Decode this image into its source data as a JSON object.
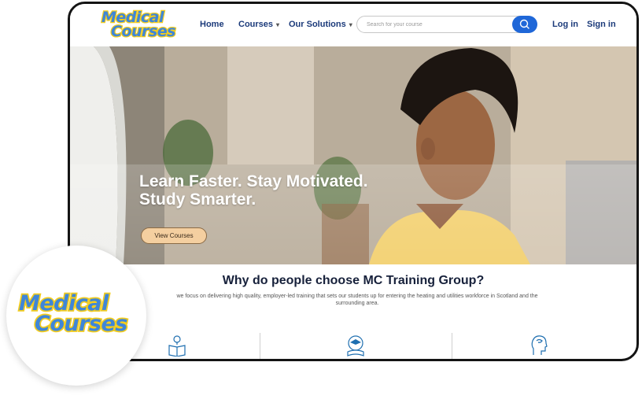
{
  "brand": {
    "logo_line1": "Medical",
    "logo_line2": "Courses"
  },
  "nav": {
    "home": "Home",
    "courses": "Courses",
    "solutions": "Our Solutions",
    "login": "Log in",
    "signin": "Sign in"
  },
  "search": {
    "placeholder": "Search for your course"
  },
  "hero": {
    "line1": "Learn Faster. Stay Motivated.",
    "line2": "Study Smarter.",
    "cta": "View Courses"
  },
  "why": {
    "title": "Why do people choose MC Training Group?",
    "subtitle": "we focus on delivering high quality, employer-led training that sets our students up for entering the heating and utilities workforce in Scotland and the surrounding area."
  },
  "features": [
    {
      "icon": "book-lightbulb-icon"
    },
    {
      "icon": "graduation-award-icon"
    },
    {
      "icon": "head-brain-icon"
    }
  ],
  "colors": {
    "accent": "#1f67d8",
    "nav_text": "#1b3a7a",
    "logo_blue": "#3f86d8",
    "logo_yellow": "#f2cc1f",
    "cta_bg": "#f4cfa0"
  }
}
